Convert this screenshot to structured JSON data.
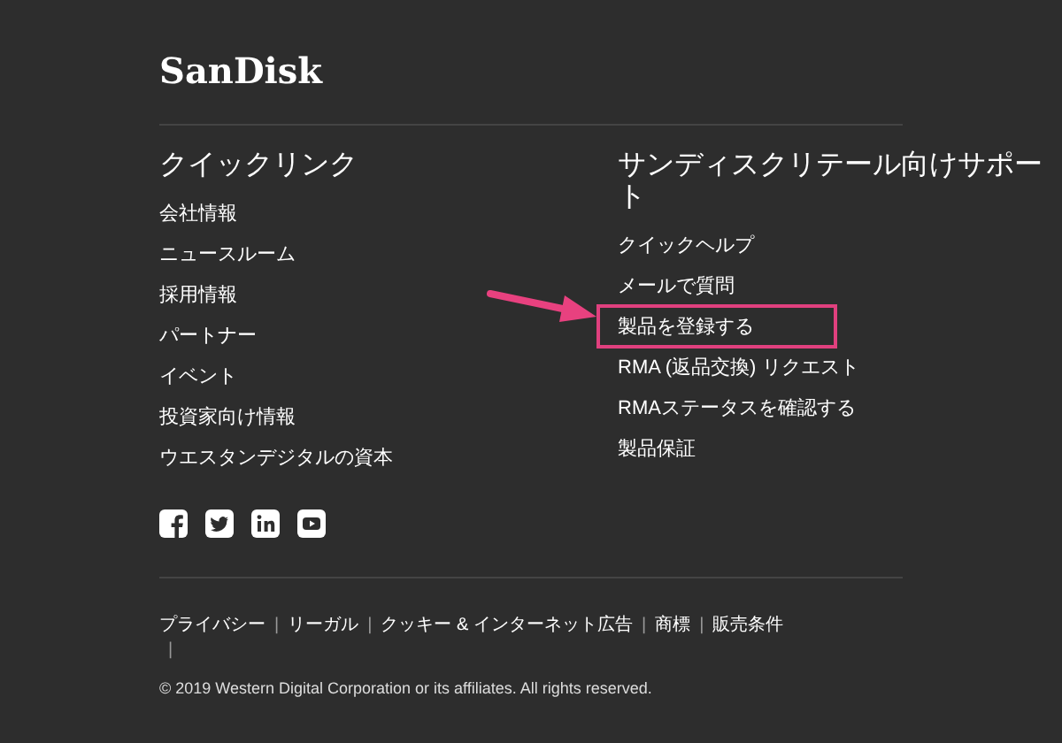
{
  "logo": "SanDisk",
  "columns": [
    {
      "heading": "クイックリンク",
      "items": [
        {
          "label": "会社情報",
          "highlighted": false
        },
        {
          "label": "ニュースルーム",
          "highlighted": false
        },
        {
          "label": "採用情報",
          "highlighted": false
        },
        {
          "label": "パートナー",
          "highlighted": false
        },
        {
          "label": "イベント",
          "highlighted": false
        },
        {
          "label": "投資家向け情報",
          "highlighted": false
        },
        {
          "label": "ウエスタンデジタルの資本",
          "highlighted": false
        }
      ]
    },
    {
      "heading": "サンディスクリテール向けサポート",
      "items": [
        {
          "label": "クイックヘルプ",
          "highlighted": false
        },
        {
          "label": "メールで質問",
          "highlighted": false
        },
        {
          "label": "製品を登録する",
          "highlighted": true
        },
        {
          "label": "RMA (返品交換) リクエスト",
          "highlighted": false
        },
        {
          "label": "RMAステータスを確認する",
          "highlighted": false
        },
        {
          "label": "製品保証",
          "highlighted": false
        }
      ]
    }
  ],
  "social": [
    {
      "kind": "facebook"
    },
    {
      "kind": "twitter"
    },
    {
      "kind": "linkedin"
    },
    {
      "kind": "youtube"
    }
  ],
  "footer_links": [
    {
      "kind": "link",
      "text": "プライバシー"
    },
    {
      "kind": "separator",
      "text": "|"
    },
    {
      "kind": "link",
      "text": "リーガル"
    },
    {
      "kind": "separator",
      "text": "|"
    },
    {
      "kind": "link",
      "text": "クッキー & インターネット広告"
    },
    {
      "kind": "separator",
      "text": "|"
    },
    {
      "kind": "link",
      "text": "商標"
    },
    {
      "kind": "separator",
      "text": "|"
    },
    {
      "kind": "link",
      "text": "販売条件"
    },
    {
      "kind": "separator",
      "text": "|"
    }
  ],
  "copyright": "© 2019 Western Digital Corporation or its affiliates. All rights reserved."
}
